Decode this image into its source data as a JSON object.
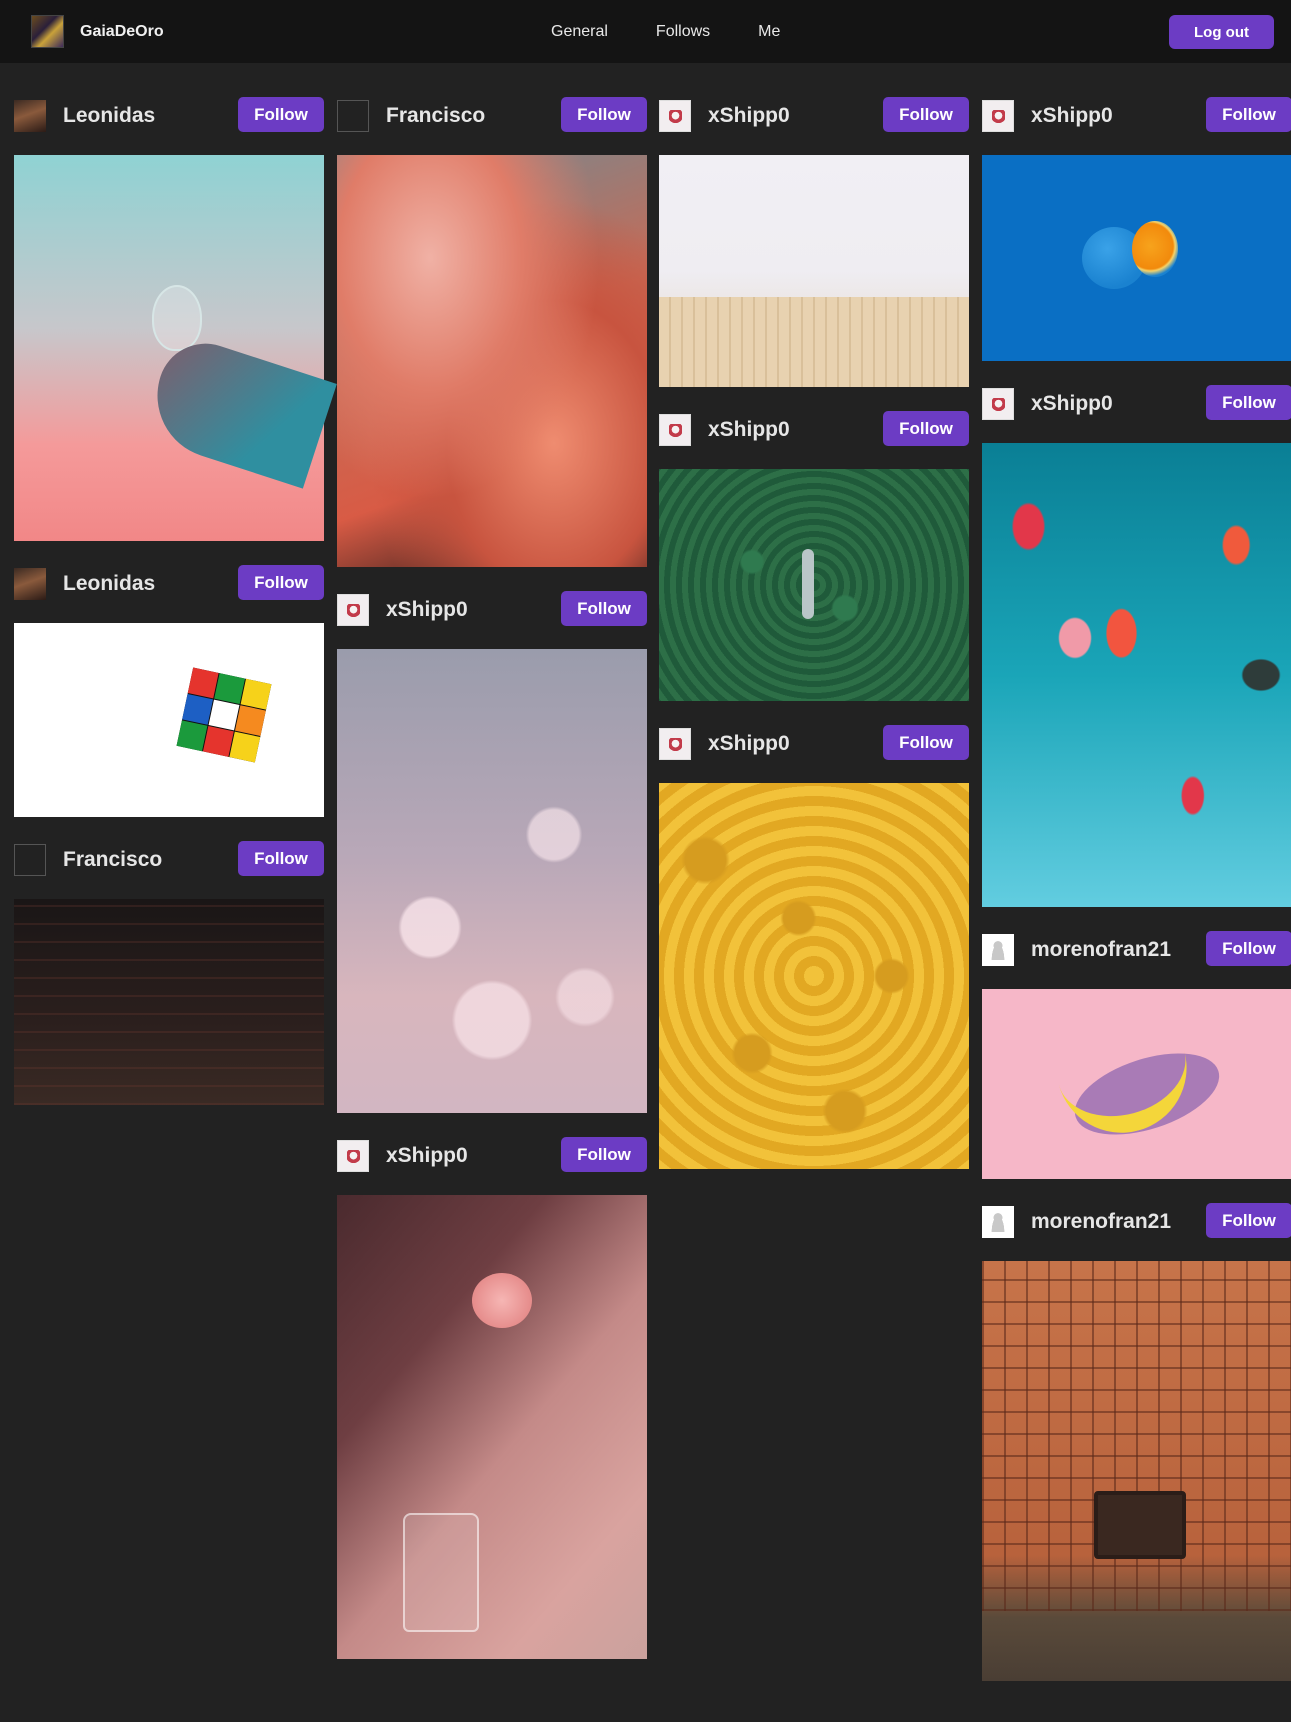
{
  "topbar": {
    "brand": "GaiaDeOro",
    "nav": [
      "General",
      "Follows",
      "Me"
    ],
    "logout_label": "Log out"
  },
  "columns": [
    [
      {
        "user": "Leonidas",
        "follow_label": "Follow",
        "avatar": "leonidas",
        "image": "bulb"
      },
      {
        "user": "Leonidas",
        "follow_label": "Follow",
        "avatar": "leonidas",
        "image": "rubik"
      },
      {
        "user": "Francisco",
        "follow_label": "Follow",
        "avatar": "broken",
        "image": "neon"
      }
    ],
    [
      {
        "user": "Francisco",
        "follow_label": "Follow",
        "avatar": "broken",
        "image": "clouds"
      },
      {
        "user": "xShipp0",
        "follow_label": "Follow",
        "avatar": "xshipp",
        "image": "bokeh"
      },
      {
        "user": "xShipp0",
        "follow_label": "Follow",
        "avatar": "xshipp",
        "image": "rose"
      }
    ],
    [
      {
        "user": "xShipp0",
        "follow_label": "Follow",
        "avatar": "xshipp",
        "image": "pencils"
      },
      {
        "user": "xShipp0",
        "follow_label": "Follow",
        "avatar": "xshipp",
        "image": "forest"
      },
      {
        "user": "xShipp0",
        "follow_label": "Follow",
        "avatar": "xshipp",
        "image": "lego"
      }
    ],
    [
      {
        "user": "xShipp0",
        "follow_label": "Follow",
        "avatar": "xshipp",
        "image": "orange"
      },
      {
        "user": "xShipp0",
        "follow_label": "Follow",
        "avatar": "xshipp",
        "image": "balloons"
      },
      {
        "user": "morenofran21",
        "follow_label": "Follow",
        "avatar": "morenofran",
        "image": "banana"
      },
      {
        "user": "morenofran21",
        "follow_label": "Follow",
        "avatar": "morenofran",
        "image": "tv"
      }
    ]
  ],
  "colors": {
    "background": "#222222",
    "topbar": "#141414",
    "accent": "#6c3cc4",
    "text": "#e6e6e6"
  }
}
